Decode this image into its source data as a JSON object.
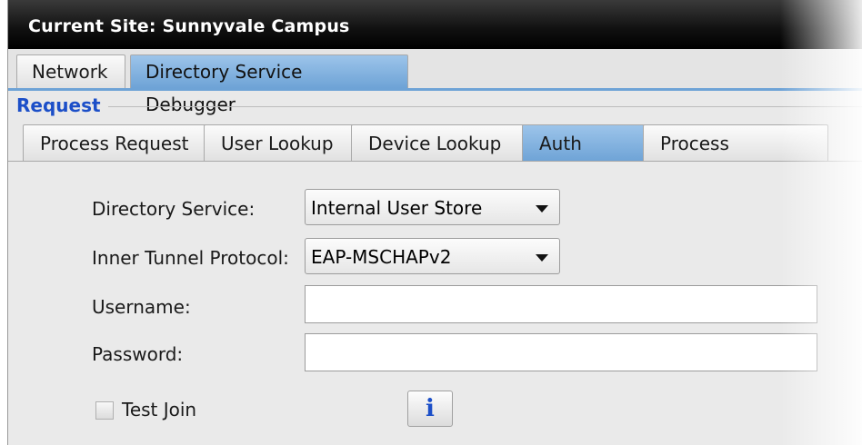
{
  "titlebar": {
    "title": "Current Site:  Sunnyvale Campus"
  },
  "top_tabs": [
    {
      "label": "Network",
      "active": false
    },
    {
      "label": "Directory Service Debugger",
      "active": true
    }
  ],
  "section": {
    "title": "Request"
  },
  "sub_tabs": [
    {
      "label": "Process Request",
      "active": false
    },
    {
      "label": "User Lookup",
      "active": false
    },
    {
      "label": "Device Lookup",
      "active": false
    },
    {
      "label": "Auth User",
      "active": true
    },
    {
      "label": "Process Kerberos",
      "active": false
    }
  ],
  "form": {
    "directory_service": {
      "label": "Directory Service:",
      "value": "Internal User Store"
    },
    "inner_tunnel_protocol": {
      "label": "Inner Tunnel Protocol:",
      "value": "EAP-MSCHAPv2"
    },
    "username": {
      "label": "Username:",
      "value": ""
    },
    "password": {
      "label": "Password:",
      "value": ""
    },
    "test_join": {
      "label": "Test Join",
      "checked": false
    },
    "info_button": {
      "glyph": "i"
    }
  },
  "colors": {
    "accent_tab": "#6ea3d6",
    "section_title": "#1c4fc8",
    "titlebar": "#000000"
  }
}
